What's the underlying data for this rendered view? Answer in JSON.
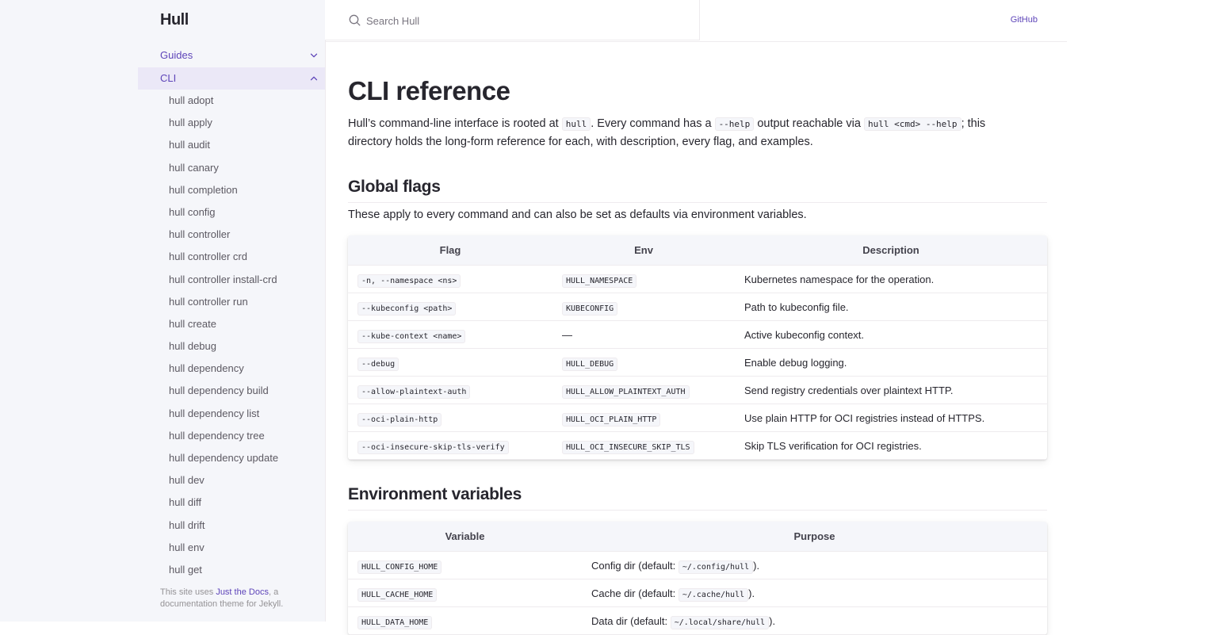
{
  "site": {
    "title": "Hull"
  },
  "header": {
    "search_placeholder": "Search Hull",
    "github_label": "GitHub"
  },
  "sidebar": {
    "top_items": [
      {
        "label": "Guides",
        "expanded": false
      },
      {
        "label": "CLI",
        "expanded": true,
        "active": true
      }
    ],
    "cli_items": [
      "hull adopt",
      "hull apply",
      "hull audit",
      "hull canary",
      "hull completion",
      "hull config",
      "hull controller",
      "hull controller crd",
      "hull controller install-crd",
      "hull controller run",
      "hull create",
      "hull debug",
      "hull dependency",
      "hull dependency build",
      "hull dependency list",
      "hull dependency tree",
      "hull dependency update",
      "hull dev",
      "hull diff",
      "hull drift",
      "hull env",
      "hull get"
    ],
    "footer": {
      "prefix": "This site uses ",
      "link": "Just the Docs",
      "suffix": ", a documentation theme for Jekyll."
    }
  },
  "page": {
    "title": "CLI reference",
    "intro": {
      "t1": "Hull’s command-line interface is rooted at ",
      "c1": "hull",
      "t2": ". Every command has a ",
      "c2": "--help",
      "t3": " output reachable via ",
      "c3": "hull <cmd> --help",
      "t4": "; this directory holds the long-form reference for each, with description, every flag, and examples."
    },
    "global_flags": {
      "heading": "Global flags",
      "lead": "These apply to every command and can also be set as defaults via environment variables.",
      "columns": [
        "Flag",
        "Env",
        "Description"
      ],
      "rows": [
        {
          "flag": "-n, --namespace <ns>",
          "env": "HULL_NAMESPACE",
          "env_is_code": true,
          "desc": "Kubernetes namespace for the operation."
        },
        {
          "flag": "--kubeconfig <path>",
          "env": "KUBECONFIG",
          "env_is_code": true,
          "desc": "Path to kubeconfig file."
        },
        {
          "flag": "--kube-context <name>",
          "env": "—",
          "env_is_code": false,
          "desc": "Active kubeconfig context."
        },
        {
          "flag": "--debug",
          "env": "HULL_DEBUG",
          "env_is_code": true,
          "desc": "Enable debug logging."
        },
        {
          "flag": "--allow-plaintext-auth",
          "env": "HULL_ALLOW_PLAINTEXT_AUTH",
          "env_is_code": true,
          "desc": "Send registry credentials over plaintext HTTP."
        },
        {
          "flag": "--oci-plain-http",
          "env": "HULL_OCI_PLAIN_HTTP",
          "env_is_code": true,
          "desc": "Use plain HTTP for OCI registries instead of HTTPS."
        },
        {
          "flag": "--oci-insecure-skip-tls-verify",
          "env": "HULL_OCI_INSECURE_SKIP_TLS",
          "env_is_code": true,
          "desc": "Skip TLS verification for OCI registries."
        }
      ]
    },
    "env_vars": {
      "heading": "Environment variables",
      "columns": [
        "Variable",
        "Purpose"
      ],
      "rows": [
        {
          "var": "HULL_CONFIG_HOME",
          "pre": "Config dir (default: ",
          "code": "~/.config/hull",
          "post": ")."
        },
        {
          "var": "HULL_CACHE_HOME",
          "pre": "Cache dir (default: ",
          "code": "~/.cache/hull",
          "post": ")."
        },
        {
          "var": "HULL_DATA_HOME",
          "pre": "Data dir (default: ",
          "code": "~/.local/share/hull",
          "post": ")."
        }
      ]
    }
  },
  "colors": {
    "accent": "#5e45b9",
    "sidebar_bg": "#f5f6fa",
    "active_bg": "#ebe8f7",
    "text": "#27262e"
  }
}
